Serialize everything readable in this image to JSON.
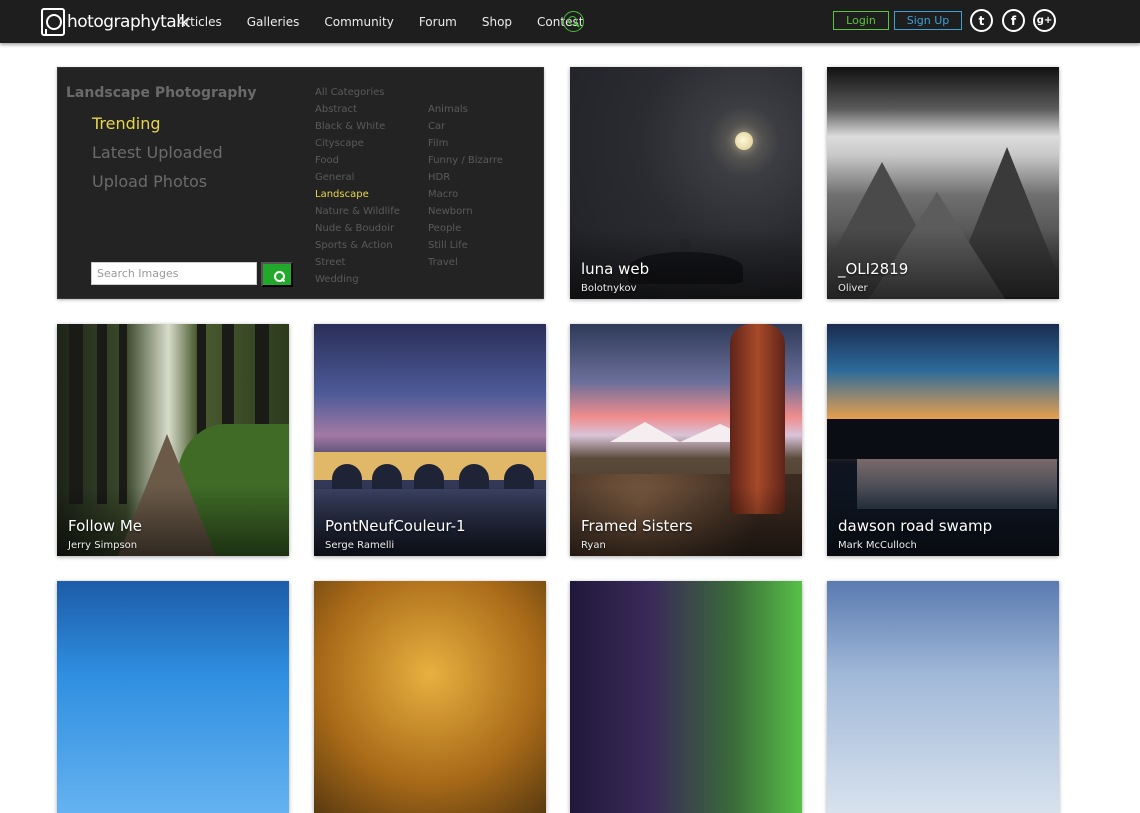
{
  "header": {
    "logo_text": "hotographytalk",
    "nav": [
      "Articles",
      "Galleries",
      "Community",
      "Forum",
      "Shop",
      "Contest"
    ],
    "login_label": "Login",
    "signup_label": "Sign Up",
    "social_labels": {
      "twitter": "t",
      "facebook": "f",
      "googleplus": "g+"
    }
  },
  "panel": {
    "title": "Landscape Photography",
    "menu": [
      "Trending",
      "Latest Uploaded",
      "Upload Photos"
    ],
    "categories_left": [
      "All Categories",
      "Abstract",
      "Black & White",
      "Cityscape",
      "Food",
      "General",
      "Landscape",
      "Nature & Wildlife",
      "Nude & Boudoir",
      "Sports & Action",
      "Street",
      "Wedding"
    ],
    "categories_right": [
      "Animals",
      "Car",
      "Film",
      "Funny / Bizarre",
      "HDR",
      "Macro",
      "Newborn",
      "People",
      "Still Life",
      "Travel"
    ],
    "active_category": "Landscape",
    "search_placeholder": "Search Images"
  },
  "photos": [
    {
      "title": "luna web",
      "author": "Bolotnykov"
    },
    {
      "title": "_OLI2819",
      "author": "Oliver"
    },
    {
      "title": "Follow Me",
      "author": "Jerry Simpson"
    },
    {
      "title": "PontNeufCouleur-1",
      "author": "Serge Ramelli"
    },
    {
      "title": "Framed Sisters",
      "author": "Ryan"
    },
    {
      "title": "dawson road swamp",
      "author": "Mark McCulloch"
    }
  ],
  "colors": {
    "accent_green": "#4cc13a",
    "accent_blue": "#3fa0d6",
    "active_yellow": "#e8d54b",
    "header_bg": "#1e1e1e",
    "panel_bg": "#232323"
  },
  "icons": {
    "logo": "camera-logo-icon",
    "search": "search-icon",
    "twitter": "twitter-icon",
    "facebook": "facebook-icon",
    "googleplus": "google-plus-icon"
  }
}
